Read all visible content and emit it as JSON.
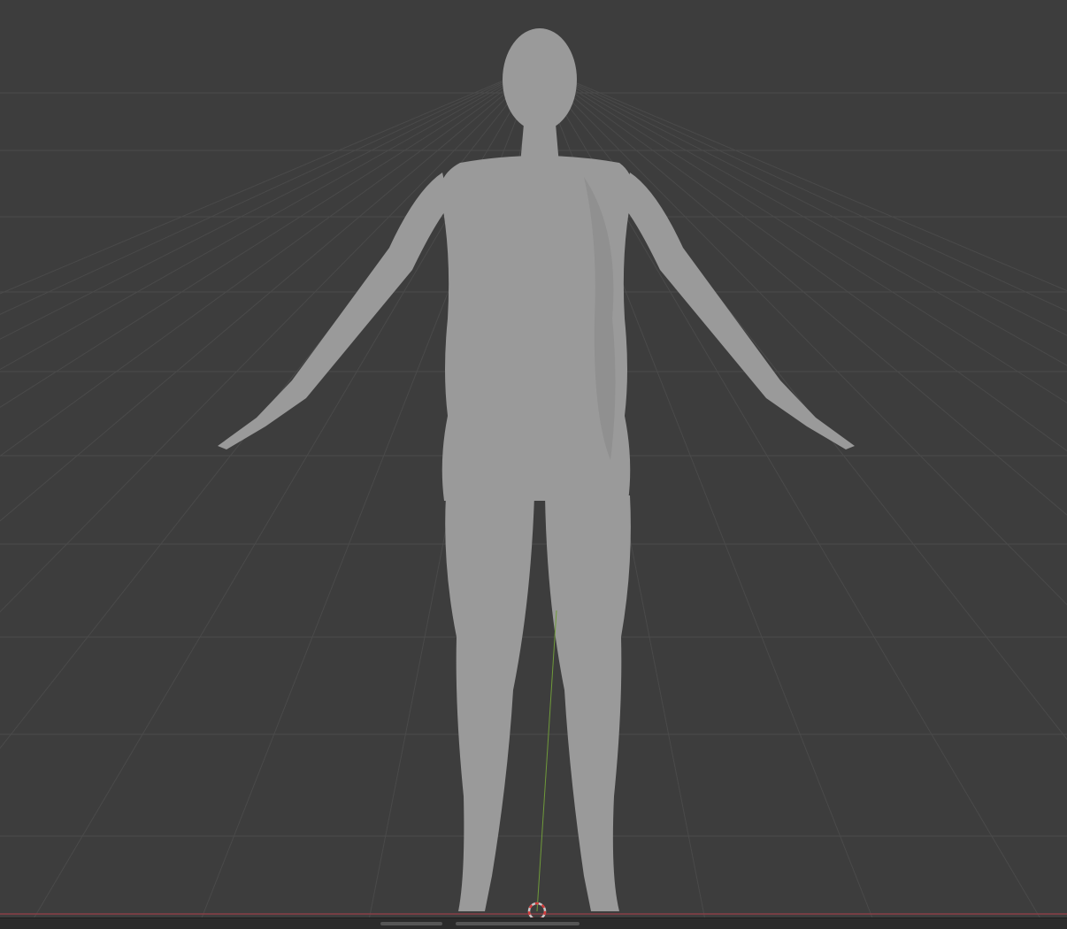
{
  "viewport": {
    "background_color": "#3d3d3d",
    "grid_color": "#4a4a4a",
    "x_axis_color": "#8a3f46",
    "y_axis_color": "#6f9a3a",
    "cursor_ring_color": "#c8c8c8",
    "cursor_dash_color": "#d23c3c",
    "model_color": "#9a9a9a",
    "model_shading_color": "#7e7e7e"
  },
  "statusbar": {
    "background_color": "#2b2b2b"
  }
}
